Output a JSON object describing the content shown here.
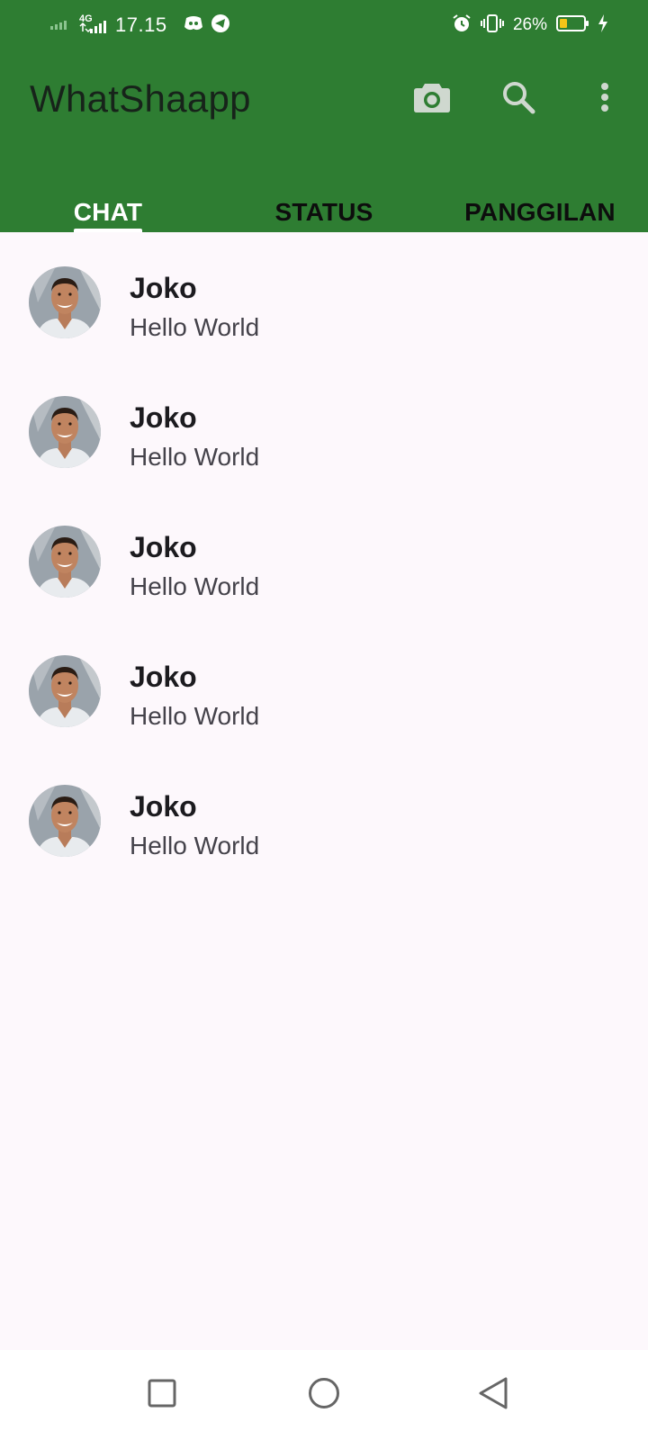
{
  "status_bar": {
    "time": "17.15",
    "network": "4G",
    "battery_percent": "26%",
    "battery_level": 0.26,
    "icons": [
      "signal-icon",
      "network-4g-icon",
      "discord-icon",
      "telegram-icon",
      "alarm-icon",
      "vibrate-icon",
      "battery-icon",
      "charging-icon"
    ]
  },
  "app_bar": {
    "title": "WhatShaapp",
    "actions": [
      "camera-icon",
      "search-icon",
      "more-vert-icon"
    ],
    "color": "#2e7d32"
  },
  "tabs": [
    {
      "label": "CHAT",
      "active": true
    },
    {
      "label": "STATUS",
      "active": false
    },
    {
      "label": "PANGGILAN",
      "active": false
    }
  ],
  "chats": [
    {
      "name": "Joko",
      "message": "Hello World"
    },
    {
      "name": "Joko",
      "message": "Hello World"
    },
    {
      "name": "Joko",
      "message": "Hello World"
    },
    {
      "name": "Joko",
      "message": "Hello World"
    },
    {
      "name": "Joko",
      "message": "Hello World"
    }
  ],
  "nav_bar": {
    "buttons": [
      "recents-square-icon",
      "home-circle-icon",
      "back-triangle-icon"
    ]
  }
}
